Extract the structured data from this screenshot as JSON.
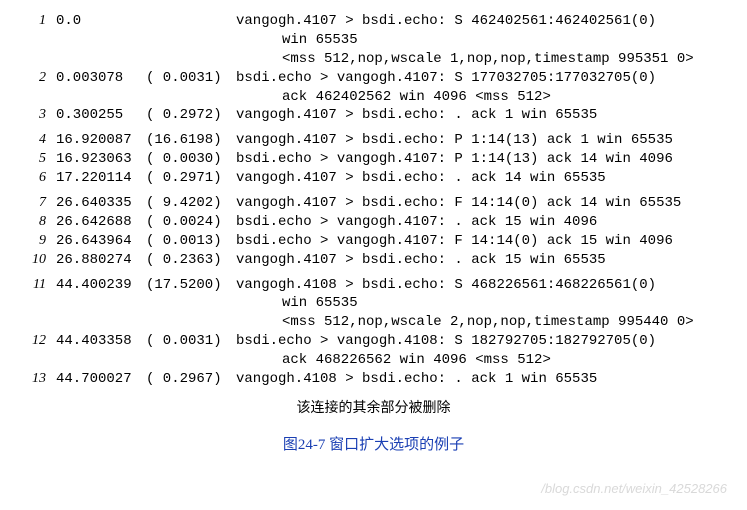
{
  "rows": [
    {
      "n": "1",
      "t": "0.0",
      "d": "",
      "p": "vangogh.4107 > bsdi.echo: S 462402561:462402561(0)",
      "cont": [
        "win 65535",
        "<mss 512,nop,wscale 1,nop,nop,timestamp 995351 0>"
      ]
    },
    {
      "n": "2",
      "t": "0.003078",
      "d": "( 0.0031)",
      "p": "bsdi.echo > vangogh.4107: S 177032705:177032705(0)",
      "cont": [
        "ack 462402562 win 4096 <mss 512>"
      ]
    },
    {
      "n": "3",
      "t": "0.300255",
      "d": "( 0.2972)",
      "p": "vangogh.4107 > bsdi.echo: . ack 1 win 65535"
    },
    {
      "gap": true
    },
    {
      "n": "4",
      "t": "16.920087",
      "d": "(16.6198)",
      "p": "vangogh.4107 > bsdi.echo: P 1:14(13) ack 1 win 65535"
    },
    {
      "n": "5",
      "t": "16.923063",
      "d": "( 0.0030)",
      "p": "bsdi.echo > vangogh.4107: P 1:14(13) ack 14 win 4096"
    },
    {
      "n": "6",
      "t": "17.220114",
      "d": "( 0.2971)",
      "p": "vangogh.4107 > bsdi.echo: . ack 14 win 65535"
    },
    {
      "gap": true
    },
    {
      "n": "7",
      "t": "26.640335",
      "d": "( 9.4202)",
      "p": "vangogh.4107 > bsdi.echo: F 14:14(0) ack 14 win 65535"
    },
    {
      "n": "8",
      "t": "26.642688",
      "d": "( 0.0024)",
      "p": "bsdi.echo > vangogh.4107: . ack 15 win 4096"
    },
    {
      "n": "9",
      "t": "26.643964",
      "d": "( 0.0013)",
      "p": "bsdi.echo > vangogh.4107: F 14:14(0) ack 15 win 4096"
    },
    {
      "n": "10",
      "t": "26.880274",
      "d": "( 0.2363)",
      "p": "vangogh.4107 > bsdi.echo: . ack 15 win 65535"
    },
    {
      "gap": true
    },
    {
      "n": "11",
      "t": "44.400239",
      "d": "(17.5200)",
      "p": "vangogh.4108 > bsdi.echo: S 468226561:468226561(0)",
      "cont": [
        "win 65535",
        "<mss 512,nop,wscale 2,nop,nop,timestamp 995440 0>"
      ]
    },
    {
      "n": "12",
      "t": "44.403358",
      "d": "( 0.0031)",
      "p": "bsdi.echo > vangogh.4108: S 182792705:182792705(0)",
      "cont": [
        "ack 468226562 win 4096 <mss 512>"
      ]
    },
    {
      "n": "13",
      "t": "44.700027",
      "d": "( 0.2967)",
      "p": "vangogh.4108 > bsdi.echo: . ack 1 win 65535"
    }
  ],
  "note": "该连接的其余部分被删除",
  "caption": "图24-7  窗口扩大选项的例子",
  "watermark": "/blog.csdn.net/weixin_42528266"
}
